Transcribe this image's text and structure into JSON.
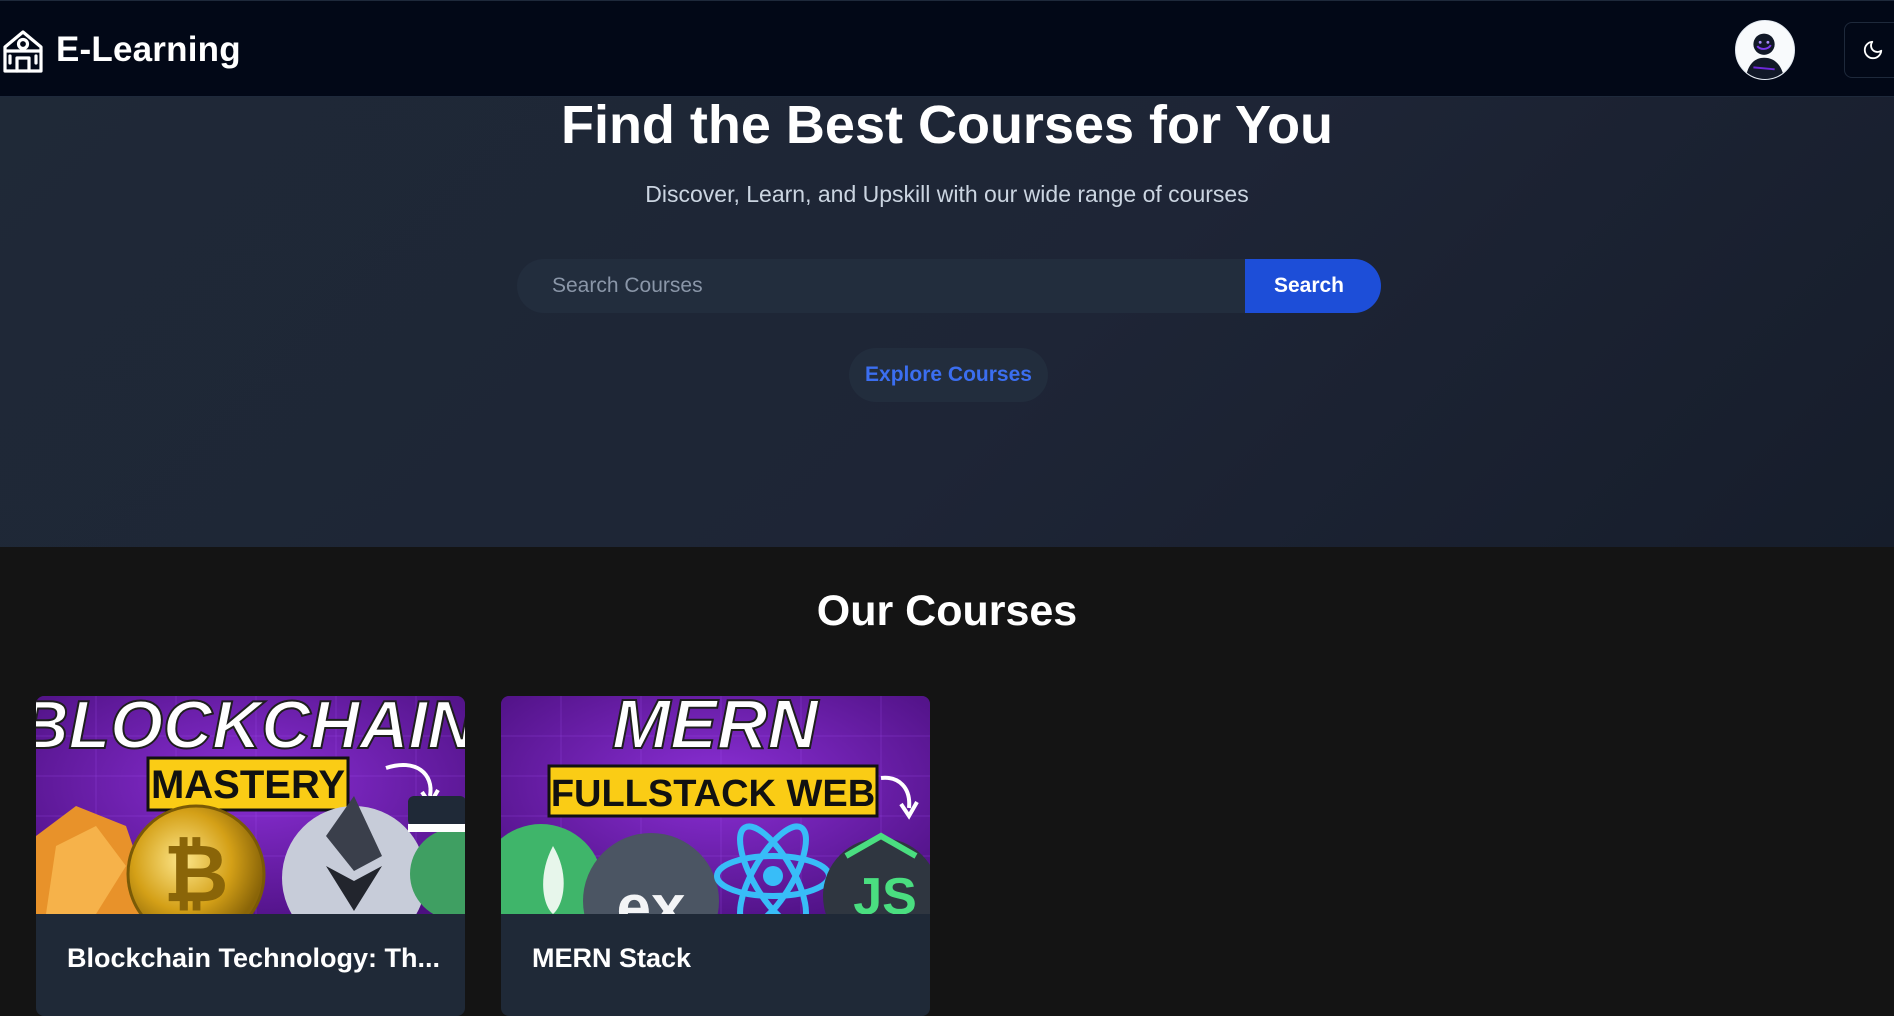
{
  "navbar": {
    "brand": "E-Learning",
    "brand_icon": "school-icon",
    "avatar_icon": "user-avatar",
    "theme_toggle_icon": "moon-icon"
  },
  "hero": {
    "title": "Find the Best Courses for You",
    "subtitle": "Discover, Learn, and Upskill with our wide range of courses",
    "search": {
      "placeholder": "Search Courses",
      "value": "",
      "button_label": "Search"
    },
    "explore_label": "Explore Courses"
  },
  "courses": {
    "title": "Our Courses",
    "items": [
      {
        "title": "Blockchain Technology: Th...",
        "thumb_line1": "BLOCKCHAIN",
        "thumb_line2": "MASTERY"
      },
      {
        "title": "MERN Stack",
        "thumb_line1": "MERN",
        "thumb_line2": "FULLSTACK WEB",
        "thumb_logos": [
          "ex",
          "JS"
        ]
      }
    ]
  },
  "colors": {
    "navbar_bg": "#020817",
    "hero_bg": "#1f2937",
    "page_bg": "#141414",
    "primary": "#1d4ed8",
    "link": "#3b6ef0",
    "card_bg": "#1f2937"
  }
}
